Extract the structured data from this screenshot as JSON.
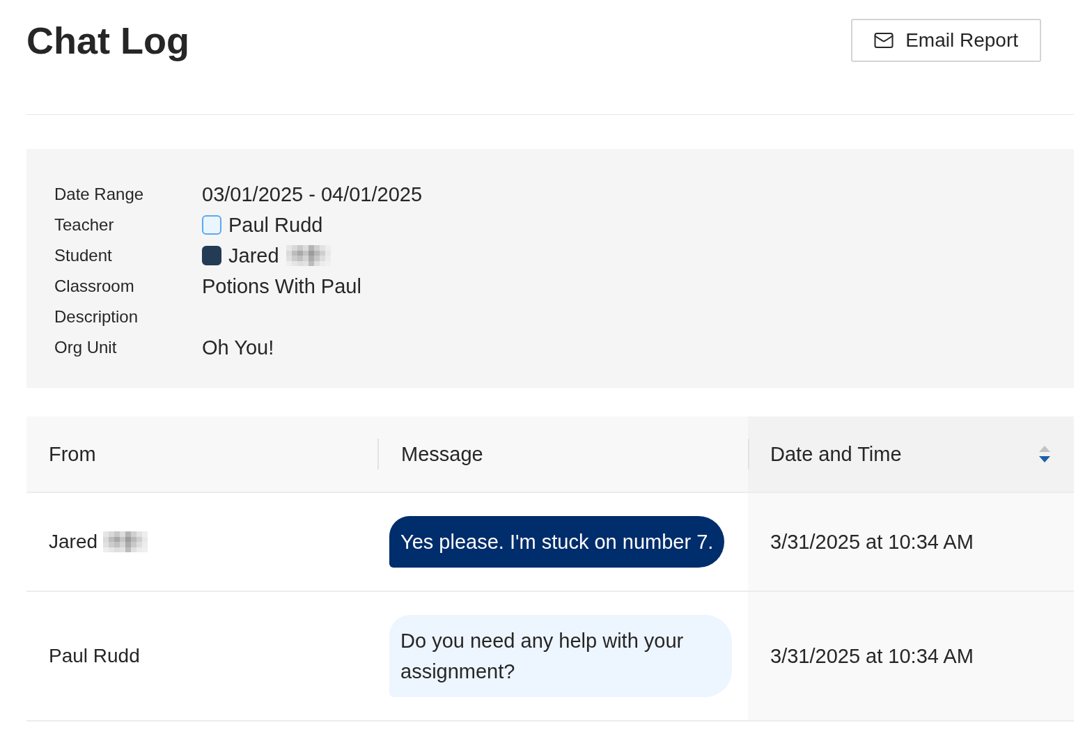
{
  "header": {
    "title": "Chat Log",
    "email_button": {
      "label": "Email Report"
    }
  },
  "details": {
    "rows": [
      {
        "label": "Date Range",
        "value": "03/01/2025 - 04/01/2025"
      },
      {
        "label": "Teacher",
        "value": "Paul Rudd",
        "redacted": false,
        "swatch": {
          "kind": "outlined",
          "color": "#5aa9ef"
        }
      },
      {
        "label": "Student",
        "value": "Jared",
        "redacted": true,
        "swatch": {
          "kind": "filled",
          "color": "#243b55"
        }
      },
      {
        "label": "Classroom",
        "value": "Potions With Paul"
      },
      {
        "label": "Description"
      },
      {
        "label": "Org Unit",
        "value": "Oh You!"
      }
    ]
  },
  "table": {
    "columns": [
      {
        "label": "From",
        "sorted": false
      },
      {
        "label": "Message",
        "sorted": false
      },
      {
        "label": "Date and Time",
        "sorted": true,
        "descending": true
      }
    ],
    "rows": [
      {
        "from": "Jared",
        "redacted": true,
        "message": {
          "kind": "student",
          "text": "Yes please. I'm stuck on number 7."
        },
        "date_time": "3/31/2025 at 10:34 AM"
      },
      {
        "from": "Paul Rudd",
        "redacted": false,
        "message": {
          "kind": "teacher",
          "text": "Do you need any help with your assignment?"
        },
        "date_time": "3/31/2025 at 10:34 AM"
      }
    ]
  }
}
